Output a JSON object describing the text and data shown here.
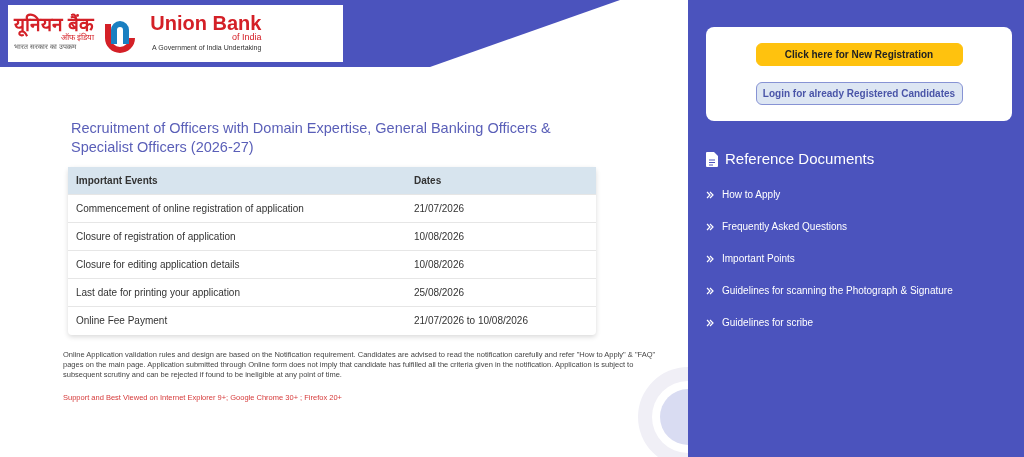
{
  "logo": {
    "hindi_name": "यूनियन बैंक",
    "hindi_sub": "ऑफ इंडिया",
    "hindi_tagline": "भारत सरकार का उपक्रम",
    "name": "Union Bank",
    "sub": "of India",
    "tagline": "A Government of India Undertaking"
  },
  "title": "Recruitment of Officers with Domain Expertise, General Banking Officers & Specialist Officers (2026-27)",
  "table": {
    "columns": [
      "Important Events",
      "Dates"
    ],
    "rows": [
      [
        "Commencement of online registration of application",
        "21/07/2026"
      ],
      [
        "Closure of registration of application",
        "10/08/2026"
      ],
      [
        "Closure for editing application details",
        "10/08/2026"
      ],
      [
        "Last date for printing your application",
        "25/08/2026"
      ],
      [
        "Online Fee Payment",
        "21/07/2026 to 10/08/2026"
      ]
    ]
  },
  "disclaimer": "Online Application validation rules and design are based on the Notification requirement. Candidates are advised to read the notification carefully and refer \"How to Apply\" & \"FAQ\" pages on the main page. Application submitted through Online form does not imply that candidate has fulfilled all the criteria given in the notification. Application is subject to subsequent scrutiny and can be rejected if found to be ineligible at any point of time.",
  "browser_note": "Support and Best Viewed on Internet Explorer 9+; Google Chrome 30+ ; Firefox 20+",
  "buttons": [
    {
      "kind": "primary",
      "label": "Click here for New Registration"
    },
    {
      "kind": "secondary",
      "label": "Login for already Registered Candidates"
    }
  ],
  "reference": {
    "heading": "Reference Documents",
    "items": [
      "How to Apply",
      "Frequently Asked Questions",
      "Important Points",
      "Guidelines for scanning the Photograph & Signature",
      "Guidelines for scribe"
    ]
  }
}
